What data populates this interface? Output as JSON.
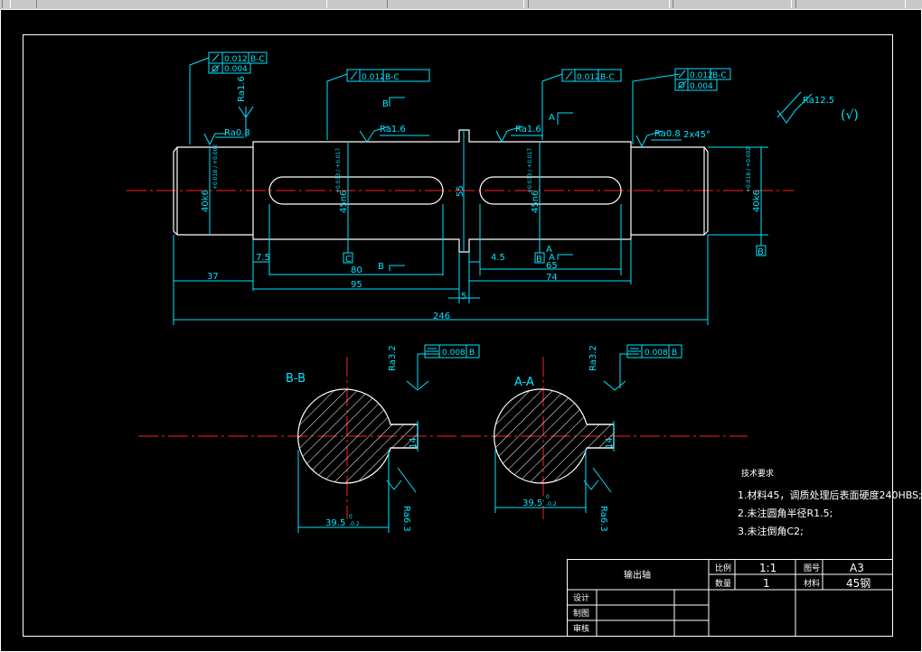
{
  "toolbar": {
    "items": [
      "",
      "",
      "",
      "",
      ""
    ]
  },
  "fcf": {
    "f1_flat": "0.012",
    "f1_ref": "B-C",
    "f1_cyl": "0.004",
    "f2": "0.012",
    "f2_ref": "B-C",
    "f3": "0.012",
    "f3_ref": "B-C",
    "f4_flat": "0.012",
    "f4_ref": "B-C",
    "f4_cyl": "0.004",
    "sec_sym": "0.008",
    "sec_ref": "B"
  },
  "roughness": {
    "r_left_top": "Ra1.6",
    "r_left": "Ra0.8",
    "r_mid": "Ra1.6",
    "r_mid2": "Ra1.6",
    "r_right": "Ra0.8",
    "r_general": "Ra12.5",
    "r_general_sym": "(√)",
    "r_sec_bb_top": "Ra3.2",
    "r_sec_aa_top": "Ra3.2",
    "r_sec_bb_bot": "Ra6.3",
    "r_sec_aa_bot": "Ra6.3"
  },
  "dims": {
    "chamfer": "2x45°",
    "d_left": "40k6",
    "d_left_tol": "+0.018 / +0.002",
    "d_mid_left": "45n6",
    "d_mid_tol": "+0.033 / +0.017",
    "d_mid_right": "45n6",
    "d_right": "40k6",
    "collar": "55",
    "dim_7_5": "7.5",
    "dim_4_5": "4.5",
    "dim_37": "37",
    "dim_80": "80",
    "dim_95": "95",
    "dim_5": "5",
    "dim_65": "65",
    "dim_74": "74",
    "dim_246": "246",
    "sec_width": "14",
    "sec_depth": "39.5",
    "sec_depth_tol_top": "0",
    "sec_depth_tol_bot": "-0.2"
  },
  "markers": {
    "c_label": "C",
    "b_label": "B",
    "b_label2": "B",
    "a_label": "A",
    "cut_b": "B",
    "cut_a": "A",
    "cut_b2": "B",
    "cut_a2": "A"
  },
  "sections": {
    "bb": "B-B",
    "aa": "A-A"
  },
  "notes": {
    "title": "技术要求",
    "line1": "1.材料45，调质处理后表面硬度240HBS;",
    "line2": "2.未注圆角半径R1.5;",
    "line3": "3.未注倒角C2;"
  },
  "titleblock": {
    "part_name": "输出轴",
    "scale_label": "比例",
    "scale_value": "1:1",
    "sheet_label": "图号",
    "sheet_value": "A3",
    "qty_label": "数量",
    "qty_value": "1",
    "mat_label": "材料",
    "mat_value": "45钢",
    "designer": "设计",
    "drawer": "制图",
    "checker": "审核"
  }
}
